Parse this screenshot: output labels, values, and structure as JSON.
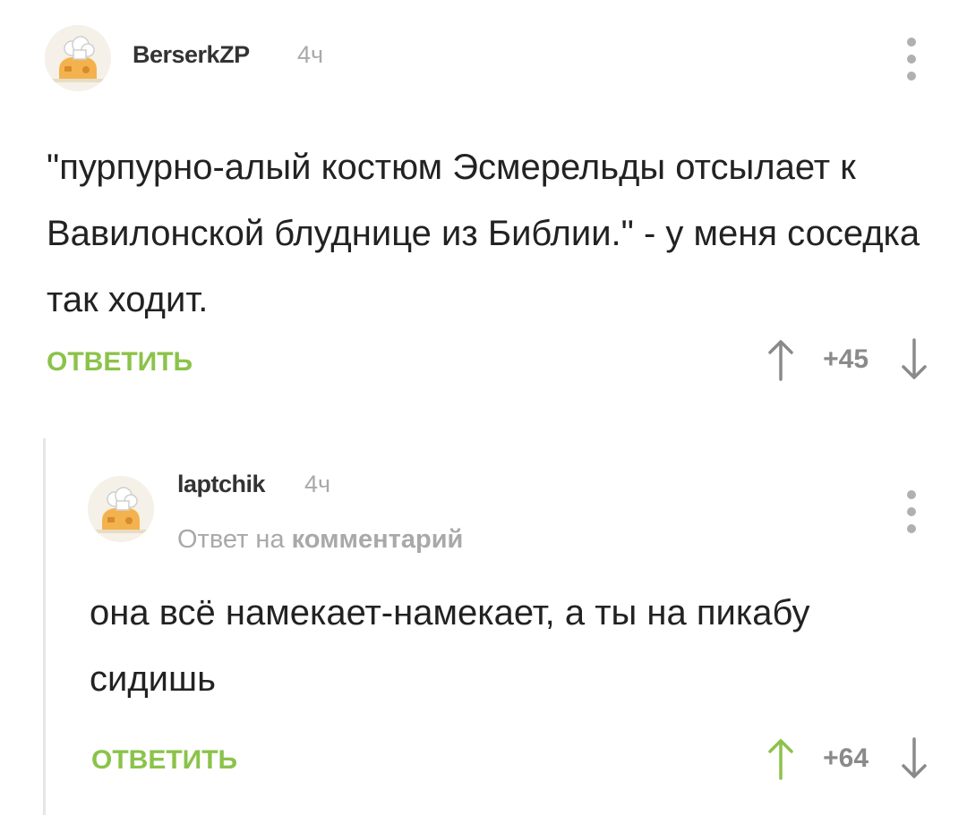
{
  "comments": [
    {
      "username": "BerserkZP",
      "time": "4ч",
      "text": "\"пурпурно-алый костюм Эсмерельды отсылает к Вавилонской блуднице из Библии.\" - у меня соседка так ходит.",
      "reply_label": "ОТВЕТИТЬ",
      "rating": "+45",
      "upvote_color": "#8a8a8a",
      "downvote_color": "#8a8a8a"
    },
    {
      "username": "laptchik",
      "time": "4ч",
      "reply_prefix": "Ответ на",
      "reply_target": "комментарий",
      "text": "она всё намекает-намекает, а ты на пикабу сидишь",
      "reply_label": "ОТВЕТИТЬ",
      "rating": "+64",
      "upvote_color": "#8bc34a",
      "downvote_color": "#8a8a8a"
    }
  ],
  "colors": {
    "accent": "#8bc34a",
    "muted": "#a9a9a9"
  }
}
